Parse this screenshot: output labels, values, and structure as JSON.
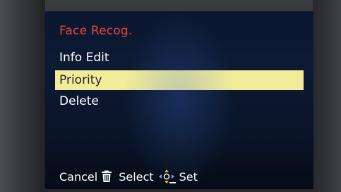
{
  "menu": {
    "title": "Face Recog.",
    "items": [
      {
        "label": "Info Edit",
        "selected": false
      },
      {
        "label": "Priority",
        "selected": true
      },
      {
        "label": "Delete",
        "selected": false
      }
    ]
  },
  "footer": {
    "cancel_label": "Cancel",
    "select_label": "Select",
    "set_label": "Set",
    "icons": [
      "trash-icon",
      "dpad-icon"
    ]
  },
  "colors": {
    "title": "#e1463c",
    "highlight": "#f2ec9a",
    "text": "#ffffff",
    "screen_bg": "#0b1730"
  }
}
